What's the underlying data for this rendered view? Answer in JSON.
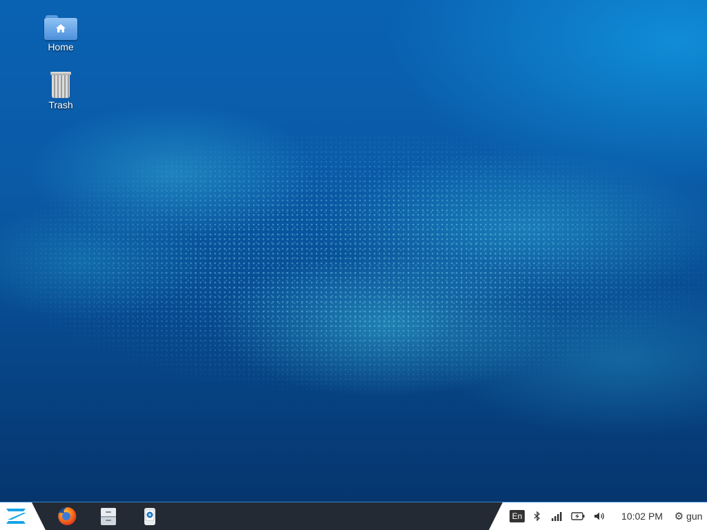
{
  "desktop": {
    "icons": [
      {
        "label": "Home",
        "icon": "home-folder-icon"
      },
      {
        "label": "Trash",
        "icon": "trash-icon"
      }
    ]
  },
  "taskbar": {
    "start_icon": "zorin-logo-icon",
    "launchers": [
      {
        "name": "Firefox",
        "icon": "firefox-icon"
      },
      {
        "name": "Files",
        "icon": "file-manager-icon"
      },
      {
        "name": "Software",
        "icon": "software-store-icon"
      }
    ],
    "tray": {
      "keyboard_layout": "En",
      "clock": "10:02 PM",
      "user": "gun"
    }
  },
  "colors": {
    "taskbar_bg": "#232a33",
    "accent": "#3a87c8",
    "tray_bg": "#ffffff"
  }
}
